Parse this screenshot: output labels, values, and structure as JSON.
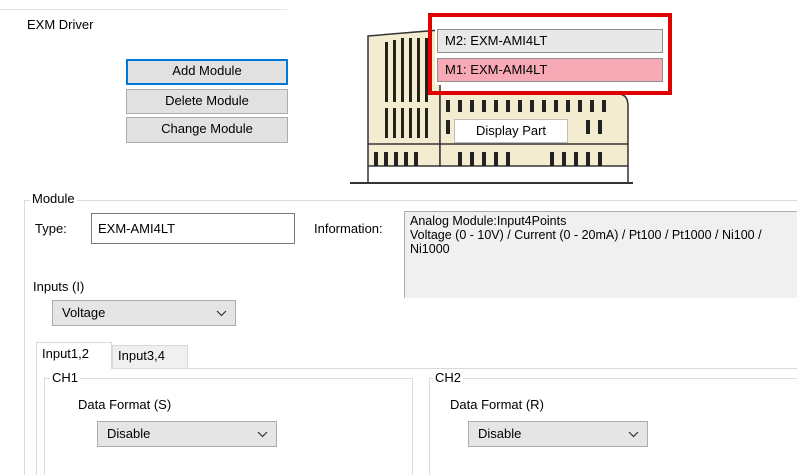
{
  "driver_label": "EXM Driver",
  "buttons": {
    "add": "Add Module",
    "delete": "Delete Module",
    "change": "Change Module"
  },
  "modules": [
    {
      "label": "M2: EXM-AMI4LT",
      "selected": false
    },
    {
      "label": "M1: EXM-AMI4LT",
      "selected": true
    }
  ],
  "display_part_label": "Display Part",
  "module_group": {
    "title": "Module",
    "type_label": "Type:",
    "type_value": "EXM-AMI4LT",
    "info_label": "Information:",
    "info_text": "Analog Module:Input4Points\nVoltage (0 - 10V) / Current (0 - 20mA) / Pt100 / Pt1000 / Ni100 / Ni1000",
    "inputs_label": "Inputs (I)",
    "inputs_value": "Voltage"
  },
  "tabs": [
    {
      "label": "Input1,2",
      "active": true
    },
    {
      "label": "Input3,4",
      "active": false
    }
  ],
  "channels": {
    "ch1": {
      "title": "CH1",
      "format_label": "Data Format (S)",
      "format_value": "Disable"
    },
    "ch2": {
      "title": "CH2",
      "format_label": "Data Format (R)",
      "format_value": "Disable"
    }
  },
  "colors": {
    "highlight_box": "#e00000",
    "selected_module_bg": "#f7a9b6",
    "device_body": "#f4ecd0"
  }
}
